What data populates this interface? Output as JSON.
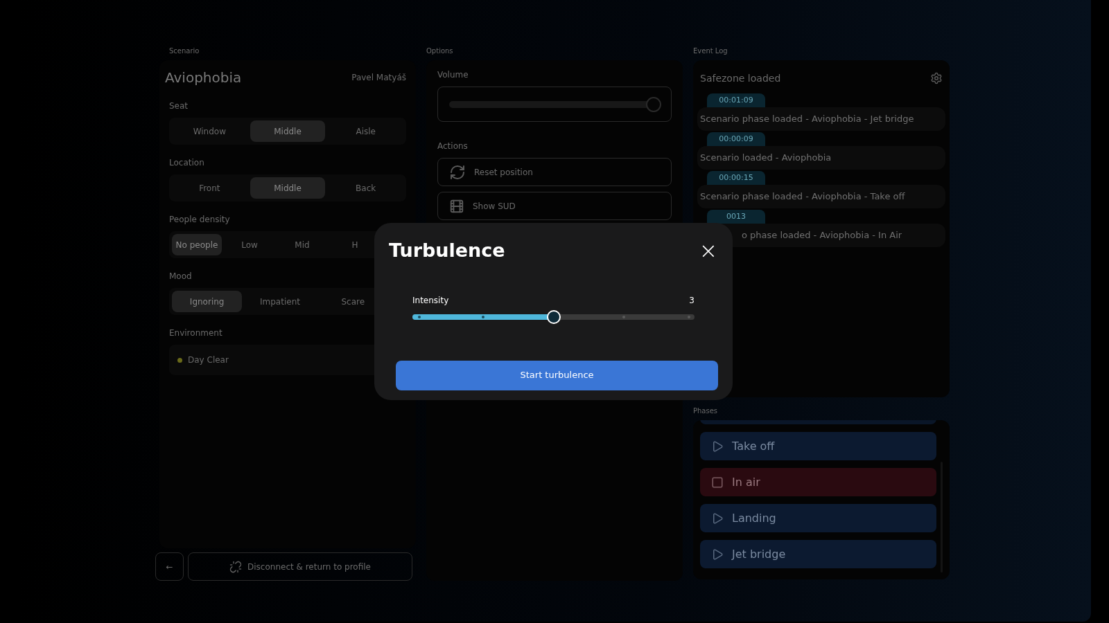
{
  "scenario": {
    "label": "Scenario",
    "title": "Aviophobia",
    "user": "Pavel Matyáš",
    "groups": [
      {
        "label": "Seat",
        "options": [
          {
            "label": "Window",
            "selected": false
          },
          {
            "label": "Middle",
            "selected": true
          },
          {
            "label": "Aisle",
            "selected": false
          }
        ]
      },
      {
        "label": "Location",
        "options": [
          {
            "label": "Front",
            "selected": false
          },
          {
            "label": "Middle",
            "selected": true
          },
          {
            "label": "Back",
            "selected": false
          }
        ]
      },
      {
        "label": "People density",
        "options": [
          {
            "label": "No people",
            "selected": true
          },
          {
            "label": "Low",
            "selected": false
          },
          {
            "label": "Mid",
            "selected": false
          },
          {
            "label": "H",
            "selected": false
          }
        ]
      },
      {
        "label": "Mood",
        "options": [
          {
            "label": "Ignoring",
            "selected": true
          },
          {
            "label": "Impatient",
            "selected": false
          },
          {
            "label": "Scare",
            "selected": false
          }
        ]
      }
    ],
    "environment": {
      "label": "Environment",
      "value": "Day Clear"
    },
    "back_button": "←",
    "disconnect_button": "Disconnect & return to profile"
  },
  "options": {
    "label": "Options",
    "volume_label": "Volume",
    "volume": {
      "level": 0.97
    },
    "actions_label": "Actions",
    "actions": [
      {
        "kind": "reset",
        "label": "Reset position"
      },
      {
        "kind": "film",
        "label": "Show SUD"
      }
    ]
  },
  "event_log": {
    "label": "Event Log",
    "header": "Safezone loaded",
    "entries": [
      {
        "time": "00:01:09",
        "text": "Scenario phase loaded - Aviophobia - Jet bridge"
      },
      {
        "time": "00:00:09",
        "text": "Scenario loaded - Aviophobia"
      },
      {
        "time": "00:00:15",
        "text": "Scenario phase loaded - Aviophobia - Take off"
      },
      {
        "time": "0013",
        "text": "o phase loaded - Aviophobia - In Air"
      }
    ]
  },
  "phases": {
    "label": "Phases",
    "items": [
      {
        "kind": "partial"
      },
      {
        "kind": "play",
        "label": "Take off",
        "selected": false
      },
      {
        "kind": "stop",
        "label": "In air",
        "selected": true
      },
      {
        "kind": "play",
        "label": "Landing",
        "selected": false
      },
      {
        "kind": "play",
        "label": "Jet bridge",
        "selected": false
      }
    ]
  },
  "dialog": {
    "title": "Turbulence",
    "close": "×",
    "slider_label": "Intensity",
    "value": "3",
    "intensity": {
      "level": 0.5
    },
    "button": "Start turbulence"
  }
}
